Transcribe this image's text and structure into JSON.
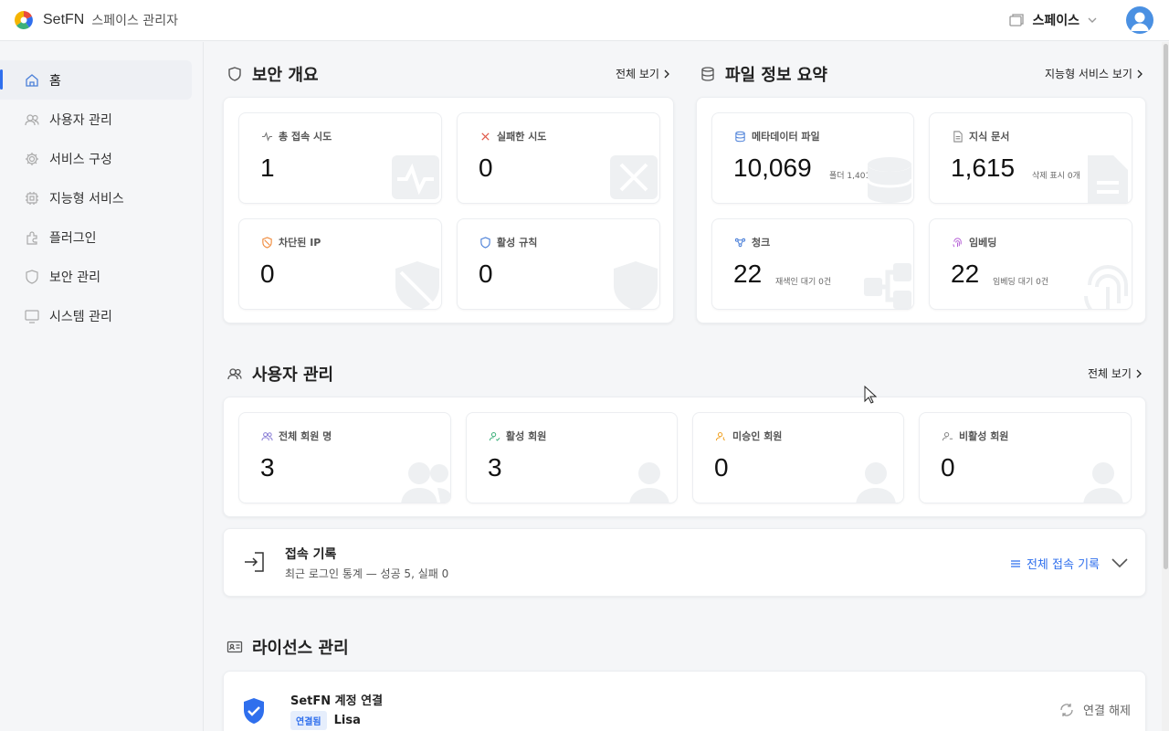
{
  "header": {
    "brand": "SetFN",
    "subtitle": "스페이스 관리자",
    "space_label": "스페이스"
  },
  "sidebar": {
    "items": [
      {
        "label": "홈",
        "icon": "home-icon",
        "active": true
      },
      {
        "label": "사용자 관리",
        "icon": "users-icon",
        "active": false
      },
      {
        "label": "서비스 구성",
        "icon": "gear-icon",
        "active": false
      },
      {
        "label": "지능형 서비스",
        "icon": "chip-icon",
        "active": false
      },
      {
        "label": "플러그인",
        "icon": "plugin-icon",
        "active": false
      },
      {
        "label": "보안 관리",
        "icon": "shield-icon",
        "active": false
      },
      {
        "label": "시스템 관리",
        "icon": "monitor-icon",
        "active": false
      }
    ]
  },
  "security": {
    "title": "보안 개요",
    "link": "전체 보기",
    "cards": [
      {
        "label": "총 접속 시도",
        "value": "1",
        "icon": "activity-icon"
      },
      {
        "label": "실패한 시도",
        "value": "0",
        "icon": "x-icon"
      },
      {
        "label": "차단된 IP",
        "value": "0",
        "icon": "shield-off-icon"
      },
      {
        "label": "활성 규칙",
        "value": "0",
        "icon": "shield-icon"
      }
    ]
  },
  "files": {
    "title": "파일 정보 요약",
    "link": "지능형 서비스 보기",
    "cards": [
      {
        "label": "메타데이터 파일",
        "value": "10,069",
        "sub": "폴더 1,401개",
        "icon": "database-icon"
      },
      {
        "label": "지식 문서",
        "value": "1,615",
        "sub": "삭제 표시 0개",
        "icon": "document-icon"
      },
      {
        "label": "청크",
        "value": "22",
        "sub": "재색인 대기 0건",
        "icon": "chunk-icon"
      },
      {
        "label": "임베딩",
        "value": "22",
        "sub": "임베딩 대기 0건",
        "icon": "fingerprint-icon"
      }
    ]
  },
  "users": {
    "title": "사용자 관리",
    "link": "전체 보기",
    "cards": [
      {
        "label": "전체 회원 명",
        "value": "3",
        "icon": "users-icon",
        "color": "#8b7fd6"
      },
      {
        "label": "활성 회원",
        "value": "3",
        "icon": "user-check-icon",
        "color": "#3bb07a"
      },
      {
        "label": "미승인 회원",
        "value": "0",
        "icon": "user-pending-icon",
        "color": "#f0a020"
      },
      {
        "label": "비활성 회원",
        "value": "0",
        "icon": "user-off-icon",
        "color": "#888888"
      }
    ]
  },
  "access": {
    "title": "접속 기록",
    "desc": "최근 로그인 통계 — 성공 5, 실패 0",
    "link": "전체 접속 기록"
  },
  "license": {
    "title": "라이선스 관리",
    "account_title": "SetFN 계정 연결",
    "badge": "연결됨",
    "user": "Lisa",
    "disconnect": "연결 해제"
  },
  "colors": {
    "accent": "#2f6fed",
    "shield": "#2f6fed"
  }
}
